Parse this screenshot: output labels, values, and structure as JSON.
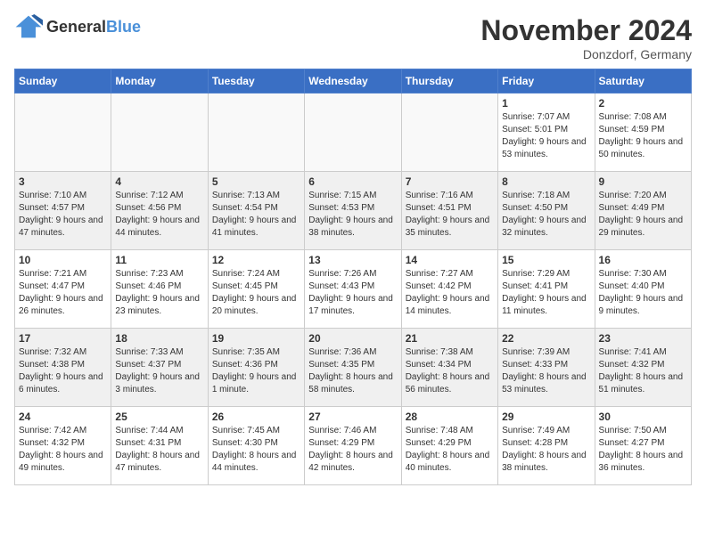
{
  "logo": {
    "general": "General",
    "blue": "Blue"
  },
  "title": "November 2024",
  "location": "Donzdorf, Germany",
  "weekdays": [
    "Sunday",
    "Monday",
    "Tuesday",
    "Wednesday",
    "Thursday",
    "Friday",
    "Saturday"
  ],
  "weeks": [
    [
      {
        "day": "",
        "info": ""
      },
      {
        "day": "",
        "info": ""
      },
      {
        "day": "",
        "info": ""
      },
      {
        "day": "",
        "info": ""
      },
      {
        "day": "",
        "info": ""
      },
      {
        "day": "1",
        "info": "Sunrise: 7:07 AM\nSunset: 5:01 PM\nDaylight: 9 hours and 53 minutes."
      },
      {
        "day": "2",
        "info": "Sunrise: 7:08 AM\nSunset: 4:59 PM\nDaylight: 9 hours and 50 minutes."
      }
    ],
    [
      {
        "day": "3",
        "info": "Sunrise: 7:10 AM\nSunset: 4:57 PM\nDaylight: 9 hours and 47 minutes."
      },
      {
        "day": "4",
        "info": "Sunrise: 7:12 AM\nSunset: 4:56 PM\nDaylight: 9 hours and 44 minutes."
      },
      {
        "day": "5",
        "info": "Sunrise: 7:13 AM\nSunset: 4:54 PM\nDaylight: 9 hours and 41 minutes."
      },
      {
        "day": "6",
        "info": "Sunrise: 7:15 AM\nSunset: 4:53 PM\nDaylight: 9 hours and 38 minutes."
      },
      {
        "day": "7",
        "info": "Sunrise: 7:16 AM\nSunset: 4:51 PM\nDaylight: 9 hours and 35 minutes."
      },
      {
        "day": "8",
        "info": "Sunrise: 7:18 AM\nSunset: 4:50 PM\nDaylight: 9 hours and 32 minutes."
      },
      {
        "day": "9",
        "info": "Sunrise: 7:20 AM\nSunset: 4:49 PM\nDaylight: 9 hours and 29 minutes."
      }
    ],
    [
      {
        "day": "10",
        "info": "Sunrise: 7:21 AM\nSunset: 4:47 PM\nDaylight: 9 hours and 26 minutes."
      },
      {
        "day": "11",
        "info": "Sunrise: 7:23 AM\nSunset: 4:46 PM\nDaylight: 9 hours and 23 minutes."
      },
      {
        "day": "12",
        "info": "Sunrise: 7:24 AM\nSunset: 4:45 PM\nDaylight: 9 hours and 20 minutes."
      },
      {
        "day": "13",
        "info": "Sunrise: 7:26 AM\nSunset: 4:43 PM\nDaylight: 9 hours and 17 minutes."
      },
      {
        "day": "14",
        "info": "Sunrise: 7:27 AM\nSunset: 4:42 PM\nDaylight: 9 hours and 14 minutes."
      },
      {
        "day": "15",
        "info": "Sunrise: 7:29 AM\nSunset: 4:41 PM\nDaylight: 9 hours and 11 minutes."
      },
      {
        "day": "16",
        "info": "Sunrise: 7:30 AM\nSunset: 4:40 PM\nDaylight: 9 hours and 9 minutes."
      }
    ],
    [
      {
        "day": "17",
        "info": "Sunrise: 7:32 AM\nSunset: 4:38 PM\nDaylight: 9 hours and 6 minutes."
      },
      {
        "day": "18",
        "info": "Sunrise: 7:33 AM\nSunset: 4:37 PM\nDaylight: 9 hours and 3 minutes."
      },
      {
        "day": "19",
        "info": "Sunrise: 7:35 AM\nSunset: 4:36 PM\nDaylight: 9 hours and 1 minute."
      },
      {
        "day": "20",
        "info": "Sunrise: 7:36 AM\nSunset: 4:35 PM\nDaylight: 8 hours and 58 minutes."
      },
      {
        "day": "21",
        "info": "Sunrise: 7:38 AM\nSunset: 4:34 PM\nDaylight: 8 hours and 56 minutes."
      },
      {
        "day": "22",
        "info": "Sunrise: 7:39 AM\nSunset: 4:33 PM\nDaylight: 8 hours and 53 minutes."
      },
      {
        "day": "23",
        "info": "Sunrise: 7:41 AM\nSunset: 4:32 PM\nDaylight: 8 hours and 51 minutes."
      }
    ],
    [
      {
        "day": "24",
        "info": "Sunrise: 7:42 AM\nSunset: 4:32 PM\nDaylight: 8 hours and 49 minutes."
      },
      {
        "day": "25",
        "info": "Sunrise: 7:44 AM\nSunset: 4:31 PM\nDaylight: 8 hours and 47 minutes."
      },
      {
        "day": "26",
        "info": "Sunrise: 7:45 AM\nSunset: 4:30 PM\nDaylight: 8 hours and 44 minutes."
      },
      {
        "day": "27",
        "info": "Sunrise: 7:46 AM\nSunset: 4:29 PM\nDaylight: 8 hours and 42 minutes."
      },
      {
        "day": "28",
        "info": "Sunrise: 7:48 AM\nSunset: 4:29 PM\nDaylight: 8 hours and 40 minutes."
      },
      {
        "day": "29",
        "info": "Sunrise: 7:49 AM\nSunset: 4:28 PM\nDaylight: 8 hours and 38 minutes."
      },
      {
        "day": "30",
        "info": "Sunrise: 7:50 AM\nSunset: 4:27 PM\nDaylight: 8 hours and 36 minutes."
      }
    ]
  ]
}
